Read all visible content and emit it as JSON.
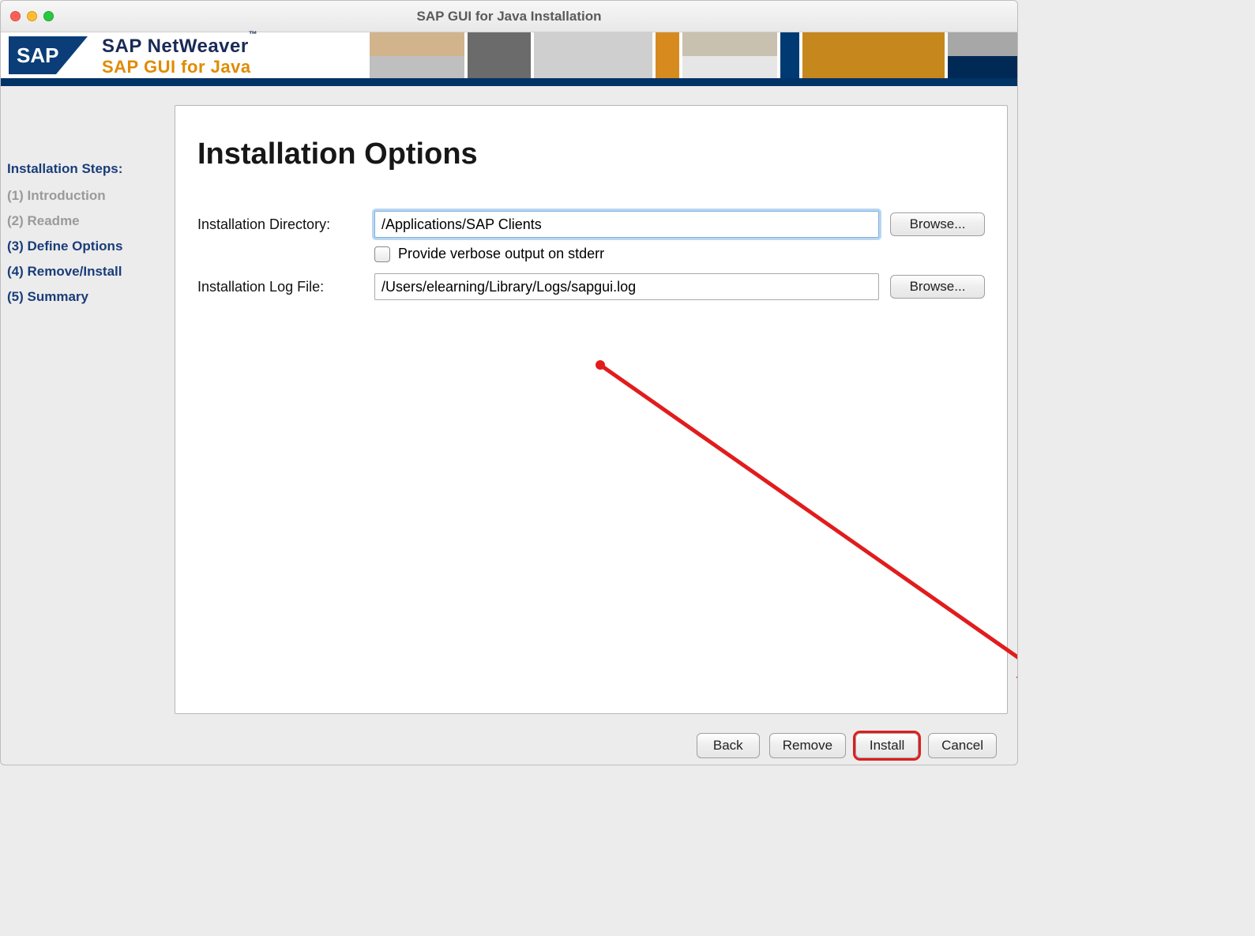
{
  "window": {
    "title": "SAP GUI for Java Installation"
  },
  "brand": {
    "logo_text": "SAP",
    "line1": "SAP NetWeaver",
    "line1_tm": "™",
    "line2": "SAP GUI for Java"
  },
  "sidebar": {
    "heading": "Installation Steps:",
    "steps": [
      {
        "label": "(1) Introduction",
        "state": "done"
      },
      {
        "label": "(2) Readme",
        "state": "done"
      },
      {
        "label": "(3) Define Options",
        "state": "active"
      },
      {
        "label": "(4) Remove/Install",
        "state": "upcoming"
      },
      {
        "label": "(5) Summary",
        "state": "upcoming"
      }
    ]
  },
  "panel": {
    "title": "Installation Options",
    "dir_label": "Installation Directory:",
    "dir_value": "/Applications/SAP Clients",
    "verbose_label": "Provide verbose output on stderr",
    "log_label": "Installation Log File:",
    "log_value": "/Users/elearning/Library/Logs/sapgui.log",
    "browse_label": "Browse..."
  },
  "footer": {
    "back": "Back",
    "remove": "Remove",
    "install": "Install",
    "cancel": "Cancel"
  }
}
